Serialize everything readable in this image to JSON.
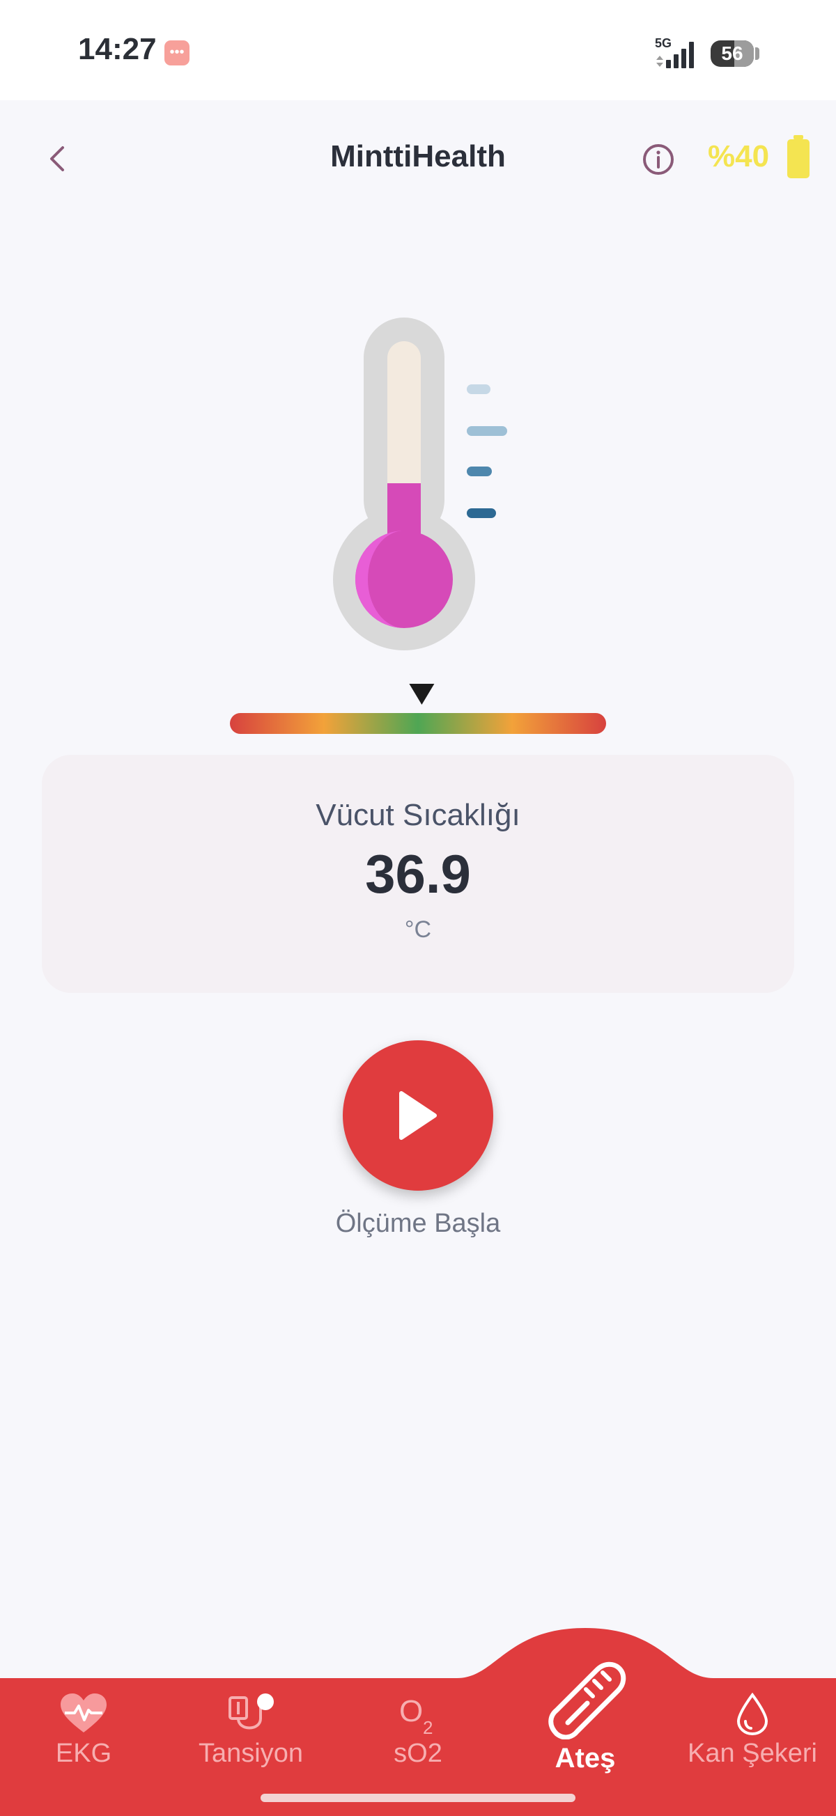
{
  "status_bar": {
    "time": "14:27",
    "network": "5G",
    "battery": "56",
    "msg_icon": "chat-bubble-icon"
  },
  "appbar": {
    "title": "MinttiHealth",
    "battery_percent": "%40",
    "back_icon": "chevron-left-icon",
    "info_icon": "info-icon",
    "battery_icon": "battery-icon"
  },
  "measurement": {
    "label": "Vücut Sıcaklığı",
    "value": "36.9",
    "unit": "°C",
    "gauge_fraction": 0.51
  },
  "action": {
    "label": "Ölçüme Başla",
    "icon": "play-icon"
  },
  "nav": {
    "items": [
      {
        "label": "EKG",
        "icon": "heart-pulse-icon",
        "active": false
      },
      {
        "label": "Tansiyon",
        "icon": "blood-pressure-icon",
        "active": false
      },
      {
        "label": "sO2",
        "icon": "oxygen-icon",
        "active": false
      },
      {
        "label": "Ateş",
        "icon": "thermometer-icon",
        "active": true
      },
      {
        "label": "Kan Şekeri",
        "icon": "blood-drop-icon",
        "active": false
      }
    ]
  },
  "colors": {
    "primary_red": "#e03c3e",
    "battery_yellow": "#f4e451",
    "thermo_fill": "#d64ab8"
  }
}
